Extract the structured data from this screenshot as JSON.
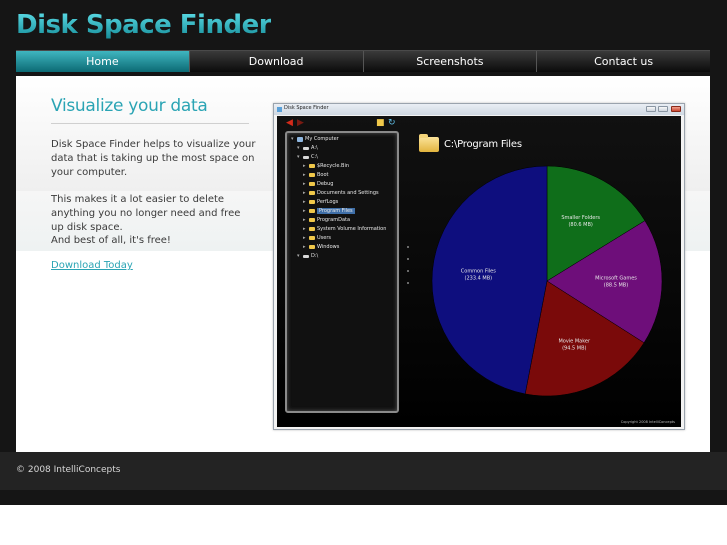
{
  "site": {
    "title": "Disk Space Finder"
  },
  "nav": {
    "items": [
      "Home",
      "Download",
      "Screenshots",
      "Contact us"
    ],
    "active": "Home"
  },
  "content": {
    "headline": "Visualize your data",
    "paragraphs": [
      "Disk Space Finder helps to visualize your data that is taking up the most space on your computer.",
      "This makes it a lot easier to delete anything you no longer need and free up disk space.",
      "And best of all, it's free!"
    ],
    "download_link": "Download Today"
  },
  "screenshot": {
    "window_title": "Disk Space Finder",
    "path_title": "C:\\Program Files",
    "tree": [
      {
        "label": "My Computer",
        "icon": "computer-icon",
        "depth": 0
      },
      {
        "label": "A:\\",
        "icon": "drive-icon",
        "depth": 1
      },
      {
        "label": "C:\\",
        "icon": "drive-icon",
        "depth": 1
      },
      {
        "label": "$Recycle.Bin",
        "icon": "folder-icon",
        "depth": 2
      },
      {
        "label": "Boot",
        "icon": "folder-icon",
        "depth": 2
      },
      {
        "label": "Debug",
        "icon": "folder-icon",
        "depth": 2
      },
      {
        "label": "Documents and Settings",
        "icon": "folder-icon",
        "depth": 2
      },
      {
        "label": "PerfLogs",
        "icon": "folder-icon",
        "depth": 2
      },
      {
        "label": "Program Files",
        "icon": "folder-icon",
        "depth": 2,
        "selected": true
      },
      {
        "label": "ProgramData",
        "icon": "folder-icon",
        "depth": 2
      },
      {
        "label": "System Volume Information",
        "icon": "folder-icon",
        "depth": 2
      },
      {
        "label": "Users",
        "icon": "folder-icon",
        "depth": 2
      },
      {
        "label": "Windows",
        "icon": "folder-icon",
        "depth": 2
      },
      {
        "label": "D:\\",
        "icon": "drive-icon",
        "depth": 1
      }
    ],
    "pie": [
      {
        "name": "Smaller Folders",
        "size": "80.6 MB",
        "value": 80.6,
        "color": "#0f6e1a"
      },
      {
        "name": "Microsoft Games",
        "size": "88.5 MB",
        "value": 88.5,
        "color": "#6e0e7a"
      },
      {
        "name": "Movie Maker",
        "size": "94.5 MB",
        "value": 94.5,
        "color": "#7a0a0a"
      },
      {
        "name": "Common Files",
        "size": "233.4 MB",
        "value": 233.4,
        "color": "#0e0e7e"
      }
    ],
    "footer": "Copyright 2008 IntelliConcepts"
  },
  "footer": {
    "copyright": "© 2008 IntelliConcepts"
  }
}
